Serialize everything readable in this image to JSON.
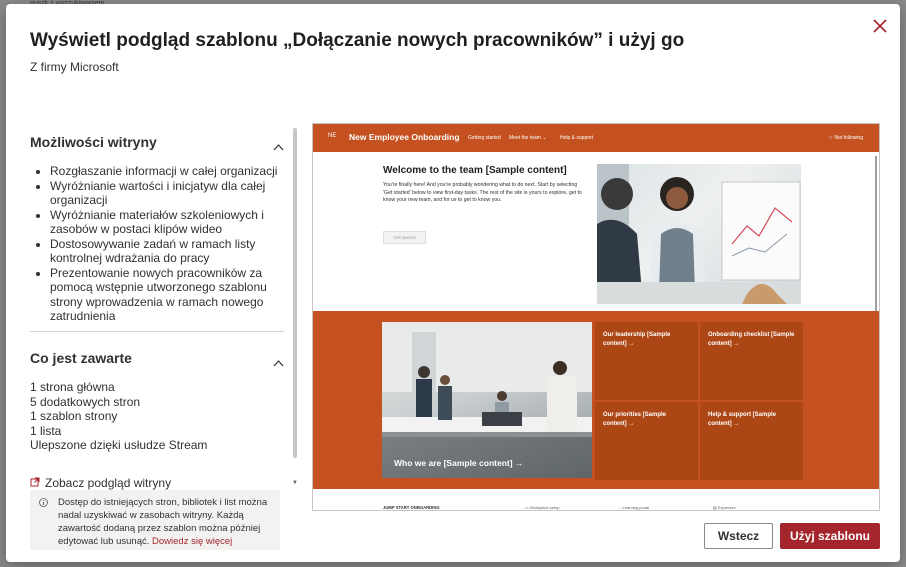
{
  "dialog": {
    "title": "Wyświetl podgląd szablonu „Dołączanie nowych pracowników” i użyj go",
    "subtitle": "Z firmy Microsoft",
    "close_icon": "close-icon"
  },
  "left": {
    "features": {
      "title": "Możliwości witryny",
      "items": [
        "Rozgłaszanie informacji w całej organizacji",
        "Wyróżnianie wartości i inicjatyw dla całej organizacji",
        "Wyróżnianie materiałów szkoleniowych i zasobów w postaci klipów wideo",
        "Dostosowywanie zadań w ramach listy kontrolnej wdrażania do pracy",
        "Prezentowanie nowych pracowników za pomocą wstępnie utworzonego szablonu strony wprowadzenia w ramach nowego zatrudnienia"
      ]
    },
    "included": {
      "title": "Co jest zawarte",
      "items": [
        "1 strona główna",
        "5 dodatkowych stron",
        "1 szablon strony",
        "1 lista",
        "Ulepszone dzięki usłudze Stream"
      ]
    },
    "preview_link": "Zobacz podgląd witryny",
    "info": {
      "text": "Dostęp do istniejących stron, bibliotek i list można nadal uzyskiwać w zasobach witryny. Każdą zawartość dodaną przez szablon można później edytować lub usunąć.",
      "link": "Dowiedz się więcej"
    }
  },
  "preview": {
    "nav": {
      "initials": "NE",
      "site_title": "New Employee Onboarding",
      "items": [
        "Getting started",
        "Meet the team",
        "Help & support"
      ],
      "follow": "Not following"
    },
    "hero": {
      "title": "Welcome to the team [Sample content]",
      "text": "You're finally here! And you're probably wondering what to do next. Start by selecting 'Get started' below to view first-day tasks. The rest of the site is yours to explore, get to know your new team, and for us to get to know you.",
      "button": "Get started"
    },
    "who": "Who we are [Sample content] →",
    "tiles": [
      "Our leadership [Sample content] →",
      "Onboarding checklist [Sample content] →",
      "Our priorities [Sample content] →",
      "Help & support [Sample content] →"
    ],
    "jump": {
      "title": "JUMP START ONBOARDING",
      "items": [
        "Workplace setup",
        "Learning portal",
        "Expenses"
      ]
    }
  },
  "buttons": {
    "back": "Wstecz",
    "use": "Użyj szablonu"
  },
  "colors": {
    "accent": "#a4262c",
    "site_orange": "#c4511f",
    "tile_orange": "#ad4615"
  }
}
